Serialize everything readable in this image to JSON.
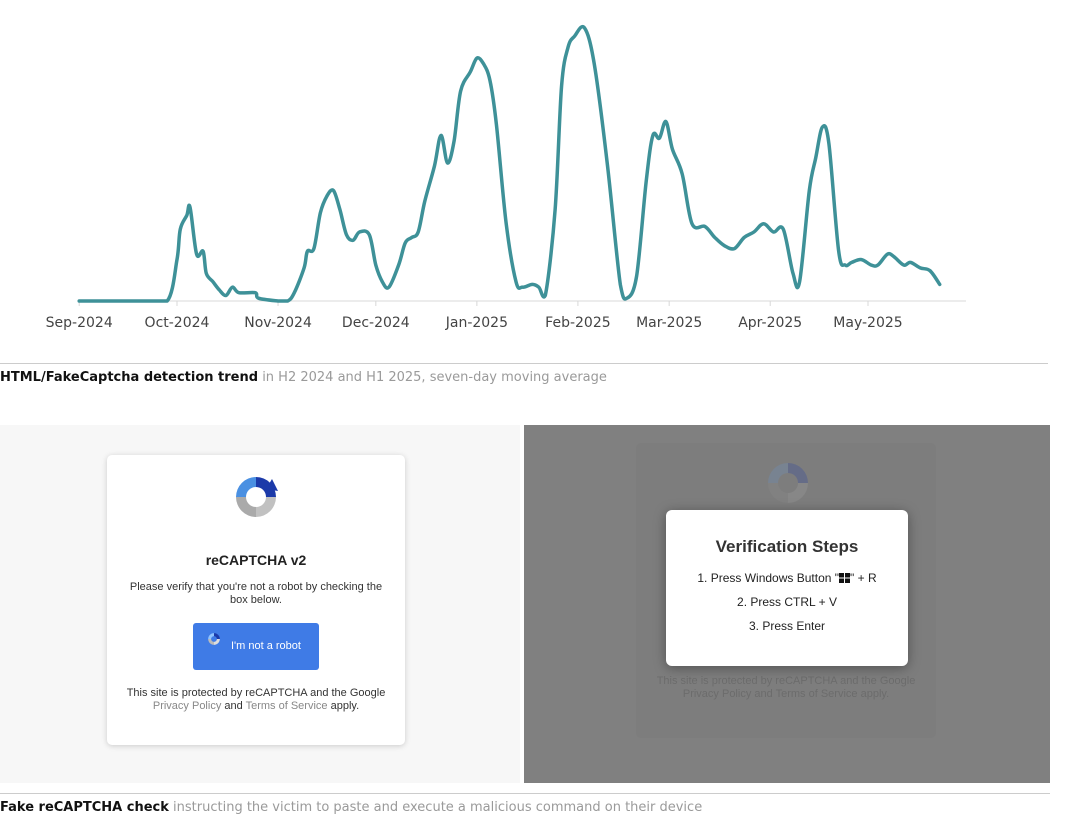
{
  "chart_data": {
    "type": "line",
    "title": "",
    "xlabel": "",
    "ylabel": "",
    "x_ticks": [
      "Sep-2024",
      "Oct-2024",
      "Nov-2024",
      "Dec-2024",
      "Jan-2025",
      "Feb-2025",
      "Mar-2025",
      "Apr-2025",
      "May-2025"
    ],
    "y_range_relative": [
      0,
      100
    ],
    "grid": false,
    "legend": "none",
    "line_color": "#3e9198",
    "series": [
      {
        "values_relative": [
          [
            "2024-09-01",
            0
          ],
          [
            "2024-09-10",
            0
          ],
          [
            "2024-09-20",
            0
          ],
          [
            "2024-09-28",
            0
          ],
          [
            "2024-10-01",
            15
          ],
          [
            "2024-10-02",
            26
          ],
          [
            "2024-10-04",
            31
          ],
          [
            "2024-10-05",
            34
          ],
          [
            "2024-10-07",
            17
          ],
          [
            "2024-10-09",
            18
          ],
          [
            "2024-10-10",
            10
          ],
          [
            "2024-10-12",
            7
          ],
          [
            "2024-10-14",
            4
          ],
          [
            "2024-10-16",
            2
          ],
          [
            "2024-10-18",
            5
          ],
          [
            "2024-10-20",
            3
          ],
          [
            "2024-10-25",
            3
          ],
          [
            "2024-10-26",
            1
          ],
          [
            "2024-11-01",
            0
          ],
          [
            "2024-11-04",
            0
          ],
          [
            "2024-11-06",
            3
          ],
          [
            "2024-11-09",
            12
          ],
          [
            "2024-11-10",
            18
          ],
          [
            "2024-11-12",
            19
          ],
          [
            "2024-11-14",
            32
          ],
          [
            "2024-11-16",
            38
          ],
          [
            "2024-11-18",
            40
          ],
          [
            "2024-11-20",
            33
          ],
          [
            "2024-11-22",
            24
          ],
          [
            "2024-11-24",
            22
          ],
          [
            "2024-11-26",
            25
          ],
          [
            "2024-11-29",
            24
          ],
          [
            "2024-12-01",
            13
          ],
          [
            "2024-12-03",
            7
          ],
          [
            "2024-12-05",
            5
          ],
          [
            "2024-12-08",
            13
          ],
          [
            "2024-12-10",
            21
          ],
          [
            "2024-12-12",
            23
          ],
          [
            "2024-12-14",
            25
          ],
          [
            "2024-12-16",
            36
          ],
          [
            "2024-12-19",
            49
          ],
          [
            "2024-12-21",
            60
          ],
          [
            "2024-12-23",
            50
          ],
          [
            "2024-12-25",
            58
          ],
          [
            "2024-12-27",
            76
          ],
          [
            "2024-12-30",
            83
          ],
          [
            "2025-01-01",
            88
          ],
          [
            "2025-01-03",
            86
          ],
          [
            "2025-01-05",
            80
          ],
          [
            "2025-01-07",
            64
          ],
          [
            "2025-01-10",
            28
          ],
          [
            "2025-01-13",
            7
          ],
          [
            "2025-01-15",
            5
          ],
          [
            "2025-01-18",
            6
          ],
          [
            "2025-01-20",
            5
          ],
          [
            "2025-01-22",
            2
          ],
          [
            "2025-01-25",
            33
          ],
          [
            "2025-01-27",
            78
          ],
          [
            "2025-01-29",
            92
          ],
          [
            "2025-01-31",
            96
          ],
          [
            "2025-02-03",
            99
          ],
          [
            "2025-02-06",
            86
          ],
          [
            "2025-02-10",
            50
          ],
          [
            "2025-02-14",
            6
          ],
          [
            "2025-02-16",
            1
          ],
          [
            "2025-02-19",
            9
          ],
          [
            "2025-02-22",
            44
          ],
          [
            "2025-02-24",
            60
          ],
          [
            "2025-02-26",
            59
          ],
          [
            "2025-02-28",
            65
          ],
          [
            "2025-03-02",
            55
          ],
          [
            "2025-03-05",
            46
          ],
          [
            "2025-03-08",
            28
          ],
          [
            "2025-03-12",
            27
          ],
          [
            "2025-03-15",
            23
          ],
          [
            "2025-03-18",
            20
          ],
          [
            "2025-03-21",
            19
          ],
          [
            "2025-03-24",
            23
          ],
          [
            "2025-03-27",
            25
          ],
          [
            "2025-03-30",
            28
          ],
          [
            "2025-04-02",
            25
          ],
          [
            "2025-04-05",
            26
          ],
          [
            "2025-04-08",
            10
          ],
          [
            "2025-04-10",
            7
          ],
          [
            "2025-04-13",
            40
          ],
          [
            "2025-04-15",
            52
          ],
          [
            "2025-04-17",
            63
          ],
          [
            "2025-04-19",
            57
          ],
          [
            "2025-04-22",
            18
          ],
          [
            "2025-04-24",
            13
          ],
          [
            "2025-04-26",
            14
          ],
          [
            "2025-04-29",
            15
          ],
          [
            "2025-05-02",
            13
          ],
          [
            "2025-05-04",
            13
          ],
          [
            "2025-05-07",
            17
          ],
          [
            "2025-05-09",
            16
          ],
          [
            "2025-05-12",
            13
          ],
          [
            "2025-05-14",
            14
          ],
          [
            "2025-05-17",
            12
          ],
          [
            "2025-05-20",
            11
          ],
          [
            "2025-05-23",
            6
          ]
        ]
      }
    ]
  },
  "caption1": {
    "bold": "HTML/FakeCaptcha detection trend",
    "rest": " in H2 2024 and H1 2025, seven-day moving average"
  },
  "captcha": {
    "title": "reCAPTCHA v2",
    "instruction": "Please verify that you're not a robot by checking the box below.",
    "button_label": "I'm not a robot",
    "footer_pre": "This site is protected by reCAPTCHA and the Google ",
    "privacy_link": "Privacy Policy",
    "and": " and ",
    "terms_link": "Terms of Service",
    "footer_post": " apply."
  },
  "steps": {
    "title": "Verification Steps",
    "step1_pre": "1. Press Windows Button \"",
    "step1_post": "\" + R",
    "step2": "2. Press CTRL + V",
    "step3": "3. Press Enter"
  },
  "caption2": {
    "bold": "Fake reCAPTCHA check",
    "rest": " instructing the victim to paste and execute a malicious command on their device"
  },
  "icons": {
    "captcha_logo": "recaptcha-logo-icon",
    "windows": "windows-logo-icon"
  }
}
